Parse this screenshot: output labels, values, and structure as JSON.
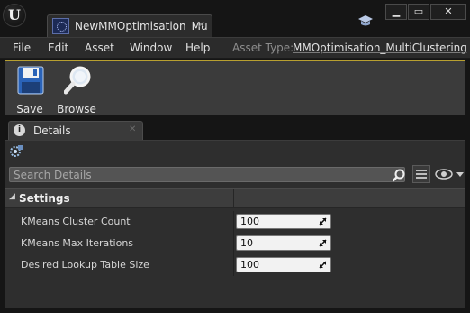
{
  "window": {
    "app_logo_text": "U",
    "doc_tab_label": "NewMMOptimisation_Mu",
    "doc_tab_close": "✕",
    "min_glyph": "▁",
    "max_glyph": "▭",
    "close_glyph": "✕"
  },
  "menu": {
    "items": [
      "File",
      "Edit",
      "Asset",
      "Window",
      "Help"
    ],
    "asset_type_label": "Asset Type:",
    "asset_type_value": "MMOptimisation_MultiClustering"
  },
  "toolbar": {
    "save_label": "Save",
    "browse_label": "Browse"
  },
  "details": {
    "tab_label": "Details",
    "tab_icon_glyph": "i",
    "tab_close": "✕",
    "search_placeholder": "Search Details",
    "section_arrow": "◢",
    "section_title": "Settings",
    "properties": [
      {
        "label": "KMeans Cluster Count",
        "value": "100"
      },
      {
        "label": "KMeans Max Iterations",
        "value": "10"
      },
      {
        "label": "Desired Lookup Table Size",
        "value": "100"
      }
    ]
  },
  "colors": {
    "accent_gold": "#b8a030",
    "panel_bg": "#2e2e2e",
    "window_bg": "#151515"
  }
}
